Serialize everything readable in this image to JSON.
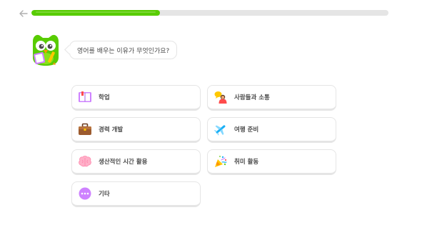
{
  "header": {
    "back_icon": "arrow-left-icon",
    "progress_fraction": 0.36,
    "progress_color": "#58cc02",
    "track_color": "#e5e5e5"
  },
  "mascot": {
    "icon": "owl-mascot-icon",
    "question": "영어를 배우는 이유가 무엇인가요?"
  },
  "options": [
    {
      "label": "학업",
      "icon": "book-icon"
    },
    {
      "label": "사람들과 소통",
      "icon": "people-chat-icon"
    },
    {
      "label": "경력 개발",
      "icon": "briefcase-icon"
    },
    {
      "label": "여행 준비",
      "icon": "airplane-icon"
    },
    {
      "label": "생산적인 시간 활용",
      "icon": "brain-icon"
    },
    {
      "label": "취미 활동",
      "icon": "party-popper-icon"
    },
    {
      "label": "기타",
      "icon": "more-dots-icon"
    }
  ]
}
